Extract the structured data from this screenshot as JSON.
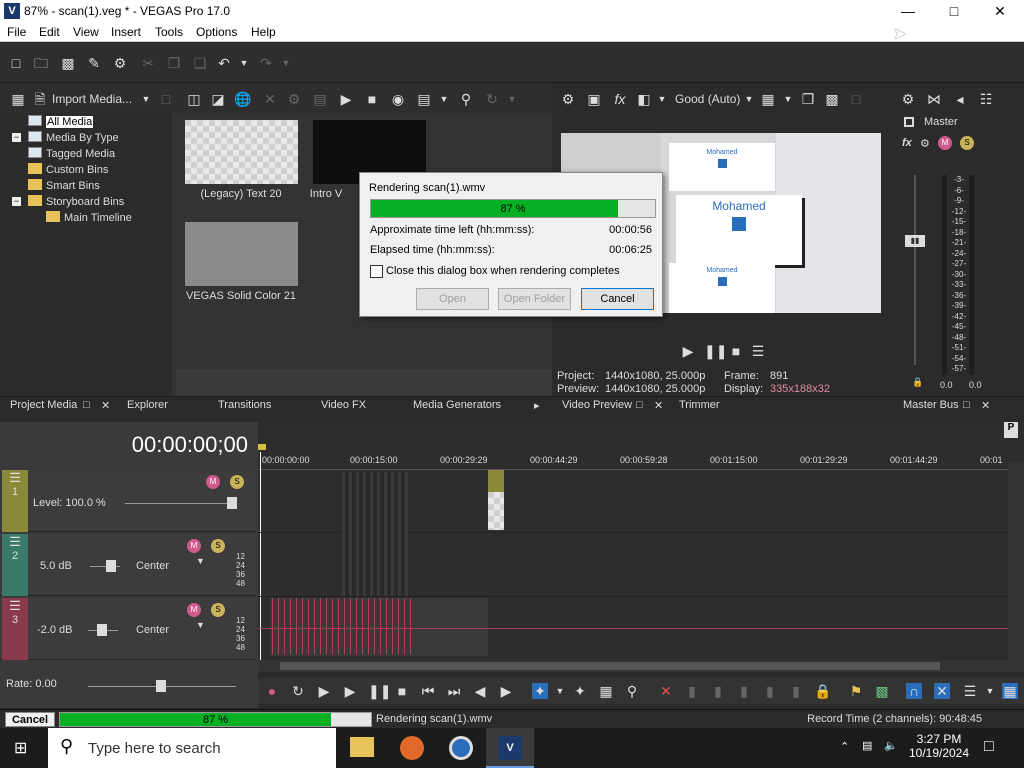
{
  "window": {
    "title": "87% - scan(1).veg * - VEGAS Pro 17.0",
    "app_icon": "V"
  },
  "menu": [
    "File",
    "Edit",
    "View",
    "Insert",
    "Tools",
    "Options",
    "Help"
  ],
  "media_toolbar": {
    "import_label": "Import Media..."
  },
  "tree": [
    "All Media",
    "Media By Type",
    "Tagged Media",
    "Custom Bins",
    "Smart Bins",
    "Storyboard Bins",
    "Main Timeline"
  ],
  "thumbs": [
    "(Legacy) Text 20",
    "Intro V",
    "VEGAS Solid Color 21"
  ],
  "preview": {
    "quality": "Good (Auto)",
    "box_small_text": "Mohamed",
    "box_big_text": "Mohamed",
    "project_label": "Project:",
    "project_value": "1440x1080, 25.000p",
    "preview_label": "Preview:",
    "preview_value": "1440x1080, 25.000p",
    "frame_label": "Frame:",
    "frame_value": "891",
    "display_label": "Display:",
    "display_value": "335x188x32"
  },
  "master": {
    "label": "Master",
    "scale": [
      "3",
      "6",
      "9",
      "12",
      "15",
      "18",
      "21",
      "24",
      "27",
      "30",
      "33",
      "36",
      "39",
      "42",
      "45",
      "48",
      "51",
      "54",
      "57"
    ],
    "left_value": "0.0",
    "right_value": "0.0"
  },
  "tabs": {
    "project_media": "Project Media",
    "explorer": "Explorer",
    "transitions": "Transitions",
    "video_fx": "Video FX",
    "media_generators": "Media Generators",
    "video_preview": "Video Preview",
    "trimmer": "Trimmer",
    "master_bus": "Master Bus"
  },
  "timeline": {
    "timecode": "00:00:00;00",
    "ruler": [
      "00:00:00:00",
      "00:00:15:00",
      "00:00:29:29",
      "00:00:44:29",
      "00:00:59:28",
      "00:01:15:00",
      "00:01:29:29",
      "00:01:44:29",
      "00:01"
    ],
    "tracks": [
      {
        "num": "1",
        "level": "Level: 100.0 %"
      },
      {
        "num": "2",
        "db": "5.0 dB",
        "pan": "Center"
      },
      {
        "num": "3",
        "db": "-2.0 dB",
        "pan": "Center"
      }
    ],
    "meter_ticks": [
      "12",
      "24",
      "36",
      "48"
    ],
    "rate": "Rate: 0.00"
  },
  "status": {
    "cancel": "Cancel",
    "progress_pct": 87,
    "progress_text": "87 %",
    "rendering": "Rendering scan(1).wmv",
    "record_time": "Record Time (2 channels): 90:48:45"
  },
  "dialog": {
    "title": "Rendering scan(1).wmv",
    "progress_pct": 87,
    "progress_text": "87 %",
    "time_left_label": "Approximate time left (hh:mm:ss):",
    "time_left_value": "00:00:56",
    "elapsed_label": "Elapsed time (hh:mm:ss):",
    "elapsed_value": "00:06:25",
    "close_checkbox": "Close this dialog box when rendering completes",
    "open": "Open",
    "open_folder": "Open Folder",
    "cancel": "Cancel"
  },
  "taskbar": {
    "search_placeholder": "Type here to search",
    "time": "3:27 PM",
    "date": "10/19/2024"
  },
  "colors": {
    "progress_green": "#06b025",
    "track1": "#8a8a3a",
    "track2": "#3a7a6a",
    "track3": "#8a3a4a"
  }
}
